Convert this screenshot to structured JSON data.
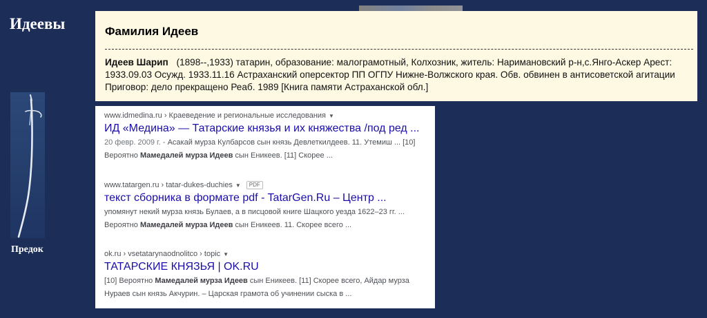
{
  "site": {
    "title": "Идеевы",
    "ancestor_label": "Предок"
  },
  "surname_card": {
    "heading": "Фамилия Идеев",
    "entry_name": "Идеев Шарип",
    "entry_text": "(1898--,1933) татарин, образование: малограмотный, Колхозник, житель: Наримановский р-н,с.Янго-Аскер Арест: 1933.09.03 Осужд. 1933.11.16 Астраханский опер­сектор ПП ОГПУ Нижне-Волжского края. Обв. обвинен в антисоветской агитации Приговор: дело прекращено Реаб. 1989 [Книга памяти Астраханской обл.]"
  },
  "search_results": [
    {
      "crumb": "www.idmedina.ru › Краеведение и региональные исследования",
      "has_pdf": false,
      "title": "ИД «Медина» — Татарские князья и их княжества /под ред ...",
      "line1_date": "20 февр. 2009 г. -",
      "line1_text": " Асакай мурза Кулбарсов сын князь Девлеткилдеев. 11. Утемиш ... [10]",
      "line2_pre": "Вероятно ",
      "line2_bold": "Мамедалей мурза Идеев",
      "line2_post": " сын Еникеев. [11] Скорее ..."
    },
    {
      "crumb": "www.tatargen.ru › tatar-dukes-duchies",
      "has_pdf": true,
      "pdf_label": "PDF",
      "title": "текст сборника в формате pdf - TatarGen.Ru – Центр ...",
      "line1_date": "",
      "line1_text": "упомянут некий мурза князь Булаев, а в писцовой книге Шацкого уезда 1622–23 гг. ...",
      "line2_pre": "Вероятно ",
      "line2_bold": "Мамедалей мурза Идеев",
      "line2_post": " сын Еникеев. 11. Скорее всего ..."
    },
    {
      "crumb": "ok.ru › vsetatarynaodnolitco › topic",
      "has_pdf": false,
      "title": "ТАТАРСКИЕ КНЯЗЬЯ | OK.RU",
      "line1_pre": "[10] Вероятно ",
      "line1_bold": "Мамедалей мурза Идеев",
      "line1_post": " сын Еникеев. [11] Скорее всего, Айдар мурза",
      "line2_text": "Нураев сын князь Акчурин. – Царская грамота об учинении сыска в ..."
    }
  ]
}
